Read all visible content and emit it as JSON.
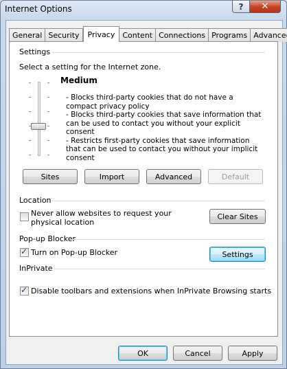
{
  "window": {
    "title": "Internet Options",
    "help_label": "?",
    "close_label": "✕"
  },
  "tabs": [
    {
      "label": "General"
    },
    {
      "label": "Security"
    },
    {
      "label": "Privacy"
    },
    {
      "label": "Content"
    },
    {
      "label": "Connections"
    },
    {
      "label": "Programs"
    },
    {
      "label": "Advanced"
    }
  ],
  "settings": {
    "group_title": "Settings",
    "prompt": "Select a setting for the Internet zone.",
    "level": "Medium",
    "description": [
      "- Blocks third-party cookies that do not have a compact privacy policy",
      "- Blocks third-party cookies that save information that can be used to contact you without your explicit consent",
      "- Restricts first-party cookies that save information that can be used to contact you without your implicit consent"
    ],
    "buttons": {
      "sites": "Sites",
      "import": "Import",
      "advanced": "Advanced",
      "default": "Default"
    }
  },
  "location": {
    "group_title": "Location",
    "checkbox_label": "Never allow websites to request your physical location",
    "checked": false,
    "clear_button": "Clear Sites"
  },
  "popup": {
    "group_title": "Pop-up Blocker",
    "checkbox_label": "Turn on Pop-up Blocker",
    "checked": true,
    "settings_button": "Settings"
  },
  "inprivate": {
    "group_title": "InPrivate",
    "checkbox_label": "Disable toolbars and extensions when InPrivate Browsing starts",
    "checked": true
  },
  "footer": {
    "ok": "OK",
    "cancel": "Cancel",
    "apply": "Apply"
  },
  "check_glyph": "✓"
}
